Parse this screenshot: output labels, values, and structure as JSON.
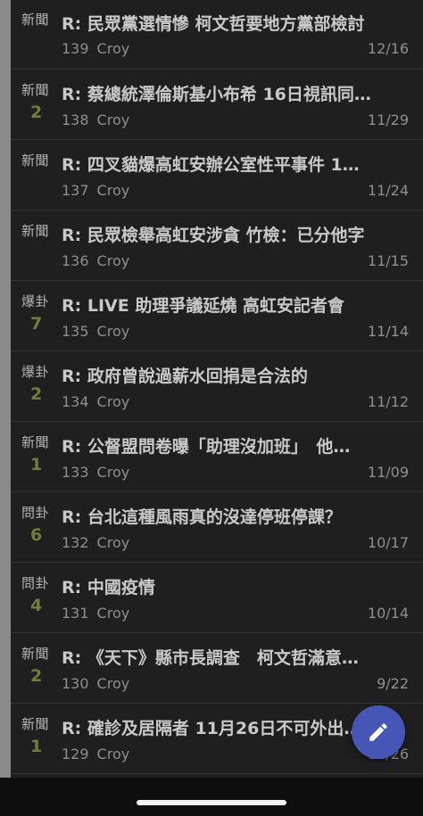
{
  "colors": {
    "background": "#1f1f1f",
    "title": "#c9c9c9",
    "meta": "#8f8f8f",
    "count": "#6f7d3a",
    "fab": "#4656b7"
  },
  "posts": [
    {
      "category": "新聞",
      "count": "",
      "title": "R: 民眾黨選情慘 柯文哲要地方黨部檢討",
      "number": "139",
      "author": "Croy",
      "date": "12/16"
    },
    {
      "category": "新聞",
      "count": "2",
      "title": "R: 蔡總統澤倫斯基小布希 16日視訊同…",
      "number": "138",
      "author": "Croy",
      "date": "11/29"
    },
    {
      "category": "新聞",
      "count": "",
      "title": "R: 四叉貓爆高虹安辦公室性平事件 1…",
      "number": "137",
      "author": "Croy",
      "date": "11/24"
    },
    {
      "category": "新聞",
      "count": "",
      "title": "R: 民眾檢舉高虹安涉貪 竹檢：已分他字",
      "number": "136",
      "author": "Croy",
      "date": "11/15"
    },
    {
      "category": "爆卦",
      "count": "7",
      "title": "R: LIVE 助理爭議延燒 高虹安記者會",
      "number": "135",
      "author": "Croy",
      "date": "11/14"
    },
    {
      "category": "爆卦",
      "count": "2",
      "title": "R: 政府曾說過薪水回捐是合法的",
      "number": "134",
      "author": "Croy",
      "date": "11/12"
    },
    {
      "category": "新聞",
      "count": "1",
      "title": "R: 公督盟問卷曝「助理沒加班」　他…",
      "number": "133",
      "author": "Croy",
      "date": "11/09"
    },
    {
      "category": "問卦",
      "count": "6",
      "title": "R: 台北這種風雨真的沒達停班停課？",
      "number": "132",
      "author": "Croy",
      "date": "10/17"
    },
    {
      "category": "問卦",
      "count": "4",
      "title": "R: 中國疫情",
      "number": "131",
      "author": "Croy",
      "date": "10/14"
    },
    {
      "category": "新聞",
      "count": "2",
      "title": "R: 《天下》縣市長調查　柯文哲滿意…",
      "number": "130",
      "author": "Croy",
      "date": "9/22"
    },
    {
      "category": "新聞",
      "count": "1",
      "title": "R: 確診及居隔者 11月26日不可外出…",
      "number": "129",
      "author": "Croy",
      "date": "11/26"
    }
  ],
  "fab": {
    "icon": "pencil-icon"
  }
}
